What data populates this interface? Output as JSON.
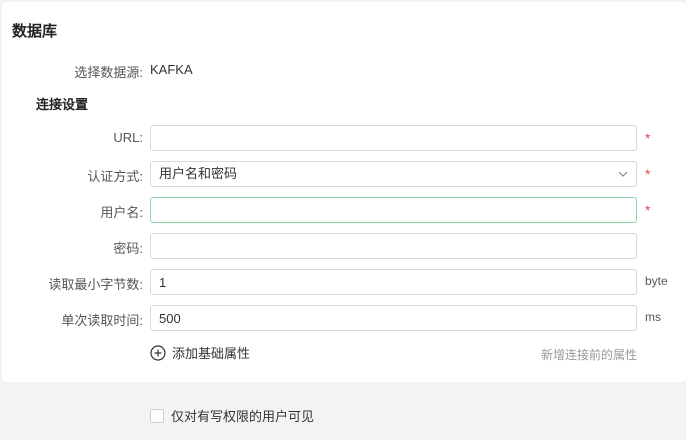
{
  "page": {
    "title": "数据库"
  },
  "source": {
    "label": "选择数据源:",
    "value": "KAFKA"
  },
  "section": {
    "title": "连接设置"
  },
  "fields": {
    "url": {
      "label": "URL:",
      "value": "",
      "required": "*"
    },
    "auth": {
      "label": "认证方式:",
      "value": "用户名和密码",
      "required": "*"
    },
    "username": {
      "label": "用户名:",
      "value": "",
      "required": "*"
    },
    "password": {
      "label": "密码:",
      "value": ""
    },
    "min_bytes": {
      "label": "读取最小字节数:",
      "value": "1",
      "unit": "byte"
    },
    "read_time": {
      "label": "单次读取时间:",
      "value": "500",
      "unit": "ms"
    }
  },
  "actions": {
    "add_attr": "添加基础属性",
    "hint": "新增连接前的属性"
  },
  "visibility": {
    "label": "仅对有写权限的用户可见",
    "checked": false
  },
  "icons": {
    "add": "plus-circle-icon",
    "dropdown": "chevron-down-icon",
    "checkbox": "checkbox-icon"
  },
  "colors": {
    "required": "#e5484d",
    "focus_border": "#8fd3a7"
  }
}
